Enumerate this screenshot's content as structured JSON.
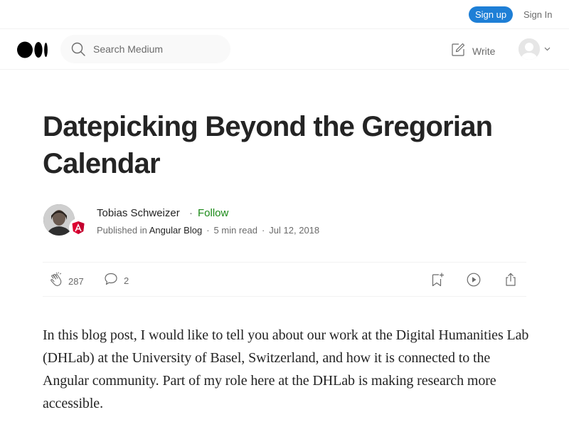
{
  "topbar": {
    "signup_label": "Sign up",
    "signin_label": "Sign In"
  },
  "navbar": {
    "logo_icon": "medium-logo-icon",
    "search": {
      "placeholder": "Search Medium",
      "value": ""
    },
    "write_label": "Write"
  },
  "article": {
    "title": "Datepicking Beyond the Gregorian Calendar",
    "author": {
      "name": "Tobias Schweizer",
      "follow_label": "Follow",
      "published_in_label": "Published in",
      "publication": "Angular Blog",
      "read_time": "5 min read",
      "date": "Jul 12, 2018"
    },
    "actions": {
      "claps": "287",
      "responses": "2"
    },
    "body": "In this blog post, I would like to tell you about our work at the Digital Humanities Lab (DHLab) at the University of Basel, Switzerland, and how it is connected to the Angular community. Part of my role here at the DHLab is making research more accessible."
  },
  "colors": {
    "signup_bg": "#1e7fd6",
    "follow": "#1a8917",
    "text": "#242424",
    "muted": "#6b6b6b",
    "angular_red": "#dd0031"
  }
}
